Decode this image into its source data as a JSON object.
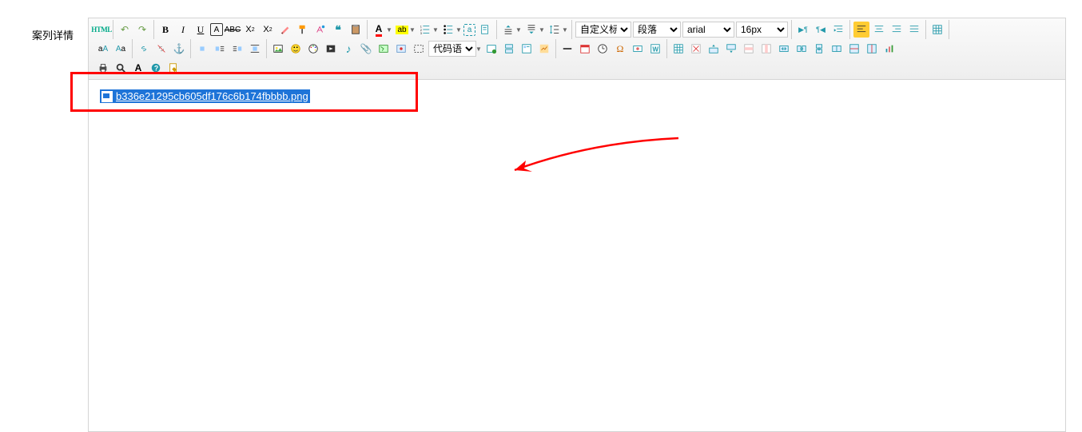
{
  "label": "案列详情",
  "content_filename": "b336e21295cb605df176c6b174fbbbb.png",
  "dropdowns": {
    "custom_title": "自定义标题",
    "paragraph": "段落",
    "font_family": "arial",
    "font_size": "16px",
    "code_lang": "代码语言"
  },
  "icons": {
    "html": "html",
    "undo": "↶",
    "redo": "↷",
    "bold": "B",
    "italic": "I",
    "underline": "U",
    "fontborder": "A",
    "strike": "abc",
    "sup": "X²",
    "sub": "X₂",
    "clear": "✎",
    "autotype": "𝒜",
    "quote": "❝",
    "pasteplain": "📋",
    "color": "A",
    "bg": "ab",
    "ol": "≡",
    "ul": "≡",
    "selall": "a",
    "search": "🔍",
    "jleft": "≡",
    "jcenter": "≡",
    "jright": "≡",
    "jfull": "≡",
    "rtl": "¶◀",
    "ltr": "▶¶",
    "ralign": "≡",
    "lalign": "≡",
    "indent": "⇥",
    "tablet": "▦",
    "touc": "A↑",
    "tolc": "A↓",
    "link": "🔗",
    "unlink": "⛓",
    "anchor": "⚓",
    "indentr": "⇥",
    "outdent": "⇤",
    "il": "≣",
    "ir": "≣",
    "img": "▦",
    "emo": "☺",
    "scrawl": "🎨",
    "video": "▶",
    "music": "♪",
    "att": "📎",
    "map": "🗺",
    "gmap": "G",
    "codebtn": "▦",
    "frame": "□",
    "tpl": "▦",
    "bgm": "▦",
    "snap": "▦",
    "hr": "—",
    "date": "📅",
    "time": "🕐",
    "sp": "Ω",
    "wd": "W",
    "ex": "X",
    "pb": "⎙",
    "table": "▦",
    "dr": "▦",
    "dc": "▦",
    "ml": "▦",
    "mr": "▦",
    "md": "▦",
    "sc": "▦",
    "ir2": "▦",
    "ic": "▦",
    "ira": "▦",
    "ica": "▦",
    "dt": "▦",
    "print": "🖶",
    "preview": "🔍",
    "srchrep": "🔧",
    "help": "?",
    "draft": "✎"
  }
}
